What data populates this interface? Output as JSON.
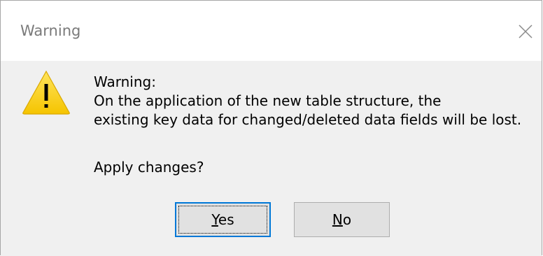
{
  "window": {
    "title": "Warning"
  },
  "icons": {
    "warning": "warning-icon",
    "close": "close-icon"
  },
  "message": {
    "line1": "Warning:",
    "line2": "On the application of the new table structure, the",
    "line3": "existing key data for changed/deleted data fields will be lost.",
    "question": "Apply changes?"
  },
  "buttons": {
    "yes": {
      "mnemonic": "Y",
      "rest": "es"
    },
    "no": {
      "mnemonic": "N",
      "rest": "o"
    }
  },
  "colors": {
    "warning_fill": "#fcd116",
    "focus_border": "#0078d7",
    "button_face": "#e1e1e1"
  }
}
